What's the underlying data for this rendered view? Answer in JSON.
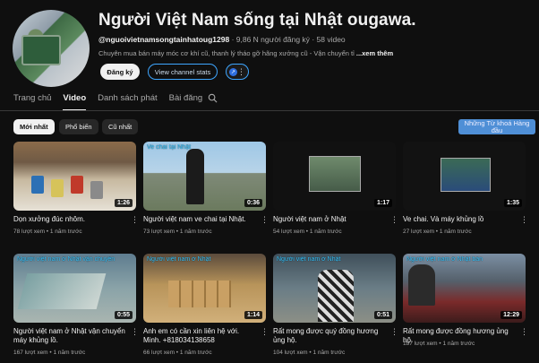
{
  "channel": {
    "title": "Người Việt Nam sống tại Nhật ougawa.",
    "handle": "@nguoivietnamsongtainhatoug1298",
    "subscribers": "9,86 N người đăng ký",
    "video_count": "58 video",
    "description": "Chuyên mua bán máy móc cơ khí cũ, thanh lý tháo gỡ hãng xưởng cũ - Vận chuyển tỉ",
    "more_label": "...xem thêm",
    "subscribe_label": "Đăng ký",
    "stats_label": "View channel stats"
  },
  "tabs": [
    {
      "label": "Trang chủ",
      "active": false
    },
    {
      "label": "Video",
      "active": true
    },
    {
      "label": "Danh sách phát",
      "active": false
    },
    {
      "label": "Bài đăng",
      "active": false
    }
  ],
  "chips": [
    "Mới nhất",
    "Phổ biến",
    "Cũ nhất"
  ],
  "promo_label": "Những Từ khoá Hàng đầu",
  "videos": [
    {
      "title": "Dọn xưởng đúc nhôm.",
      "views": "78 lượt xem",
      "age": "1 năm trước",
      "duration": "1:26",
      "overlay": ""
    },
    {
      "title": "Người việt nam ve chai tại Nhật.",
      "views": "73 lượt xem",
      "age": "1 năm trước",
      "duration": "0:36",
      "overlay": "Ve chai tại Nhật"
    },
    {
      "title": "Người việt nam ở Nhật",
      "views": "54 lượt xem",
      "age": "1 năm trước",
      "duration": "1:17",
      "overlay": ""
    },
    {
      "title": "Ve chai. Và máy khủng lồ",
      "views": "27 lượt xem",
      "age": "1 năm trước",
      "duration": "1:35",
      "overlay": ""
    },
    {
      "title": "Người việt nam ở Nhật vận chuyển máy khủng lồ.",
      "views": "167 lượt xem",
      "age": "1 năm trước",
      "duration": "0:55",
      "overlay": "Người việt nam ở Nhật vận chuyển"
    },
    {
      "title": "Anh em có cần xin liên hệ với. Minh. +818034138658",
      "views": "66 lượt xem",
      "age": "1 năm trước",
      "duration": "1:14",
      "overlay": "Người việt nam ở Nhật"
    },
    {
      "title": "Rất mong được quý đồng hương ủng hộ.",
      "views": "104 lượt xem",
      "age": "1 năm trước",
      "duration": "0:51",
      "overlay": "Người việt nam ở Nhật"
    },
    {
      "title": "Rất mong được đồng hương ủng hộ.",
      "views": "187 lượt xem",
      "age": "1 năm trước",
      "duration": "12:29",
      "overlay": "Người việt nam ở Nhật bán"
    }
  ]
}
